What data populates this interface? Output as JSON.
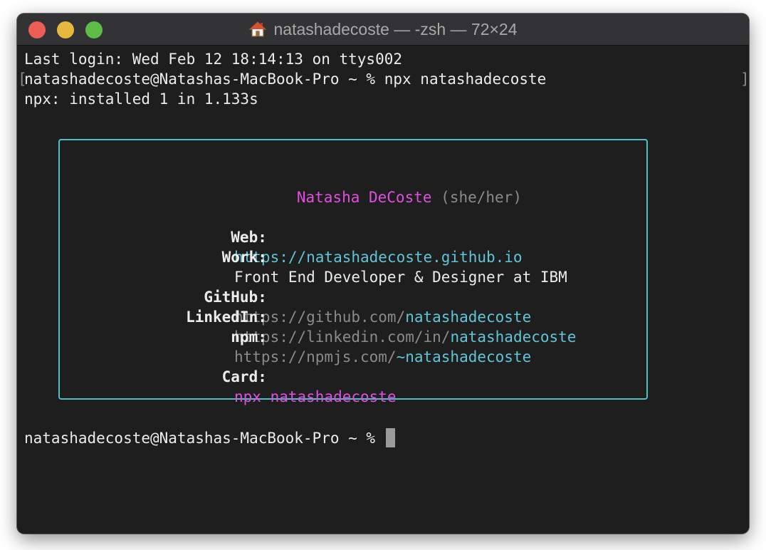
{
  "window": {
    "title": "natashadecoste — -zsh — 72×24",
    "title_icon": "home-icon"
  },
  "terminal": {
    "line1": "Last login: Wed Feb 12 18:14:13 on ttys002",
    "line2_prompt": "natashadecoste@Natashas-MacBook-Pro ~ % ",
    "line2_command": "npx natashadecoste",
    "line3": "npx: installed 1 in 1.133s",
    "bracket_left": "[",
    "bracket_right": "]",
    "final_prompt": "natashadecoste@Natashas-MacBook-Pro ~ % "
  },
  "card": {
    "name": "Natasha DeCoste",
    "pronouns": "(she/her)",
    "web_label": "Web:",
    "web_value": "https://natashadecoste.github.io",
    "work_label": "Work:",
    "work_value": "Front End Developer & Designer at IBM",
    "github_label": "GitHub:",
    "github_prefix": "https://github.com/",
    "github_user": "natashadecoste",
    "linkedin_label": "LinkedIn:",
    "linkedin_prefix": "https://linkedin.com/in/",
    "linkedin_user": "natashadecoste",
    "npm_label": "npm:",
    "npm_prefix": "https://npmjs.com/",
    "npm_user": "~natashadecoste",
    "card_label": "Card:",
    "card_value": "npx natashadecoste"
  },
  "colors": {
    "magenta": "#e14fe0",
    "cyan": "#5fc6d8",
    "border": "#4ec0c6",
    "background": "#1e1e1e"
  }
}
